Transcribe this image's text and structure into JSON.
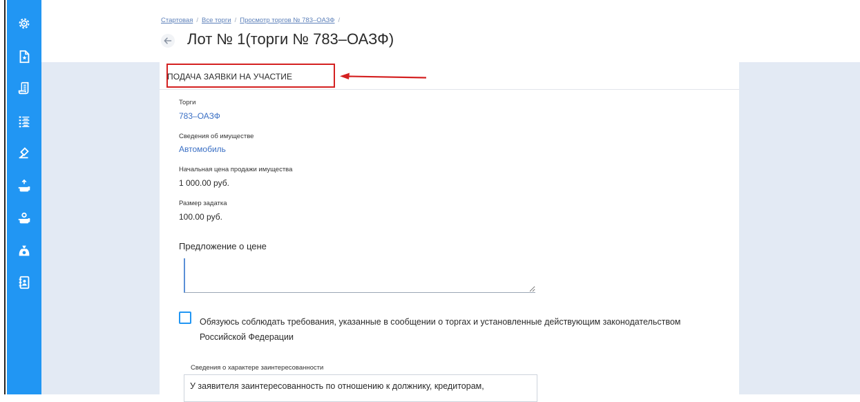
{
  "sidebar": {
    "items": [
      {
        "icon": "settings-gear-icon"
      },
      {
        "icon": "document-star-icon"
      },
      {
        "icon": "scroll-icon"
      },
      {
        "icon": "list-icon"
      },
      {
        "icon": "gavel-icon"
      },
      {
        "icon": "weight-up-icon"
      },
      {
        "icon": "weight-icon"
      },
      {
        "icon": "money-bag-icon"
      },
      {
        "icon": "contacts-book-icon"
      }
    ],
    "color": "#2196f3"
  },
  "breadcrumb": {
    "items": [
      "Стартовая",
      "Все торги",
      "Просмотр торгов № 783–ОАЗФ"
    ],
    "separator": "/"
  },
  "header": {
    "title": "Лот № 1(торги № 783–ОАЗФ)"
  },
  "form": {
    "section_title": "ПОДАЧА ЗАЯВКИ НА УЧАСТИЕ",
    "fields": [
      {
        "label": "Торги",
        "value": "783–ОАЗФ"
      },
      {
        "label": "Сведения об имуществе",
        "value": "Автомобиль"
      },
      {
        "label": "Начальная цена продажи имущества",
        "value": "1 000.00 руб."
      },
      {
        "label": "Размер задатка",
        "value": "100.00 руб."
      }
    ],
    "price_offer_label": "Предложение о цене",
    "price_offer_value": "",
    "agreement_text": "Обязуюсь соблюдать требования, указанные в сообщении о торгах и установленные действующим законодательством Российской Федерации",
    "agreement_checked": false,
    "interest_label": "Сведения о характере заинтересованности",
    "interest_text": "У заявителя заинтересованность по отношению к должнику, кредиторам,"
  },
  "colors": {
    "accent": "#2196f3",
    "link": "#3a6fc4",
    "highlight": "#d42020",
    "background": "#e3eaf4"
  }
}
